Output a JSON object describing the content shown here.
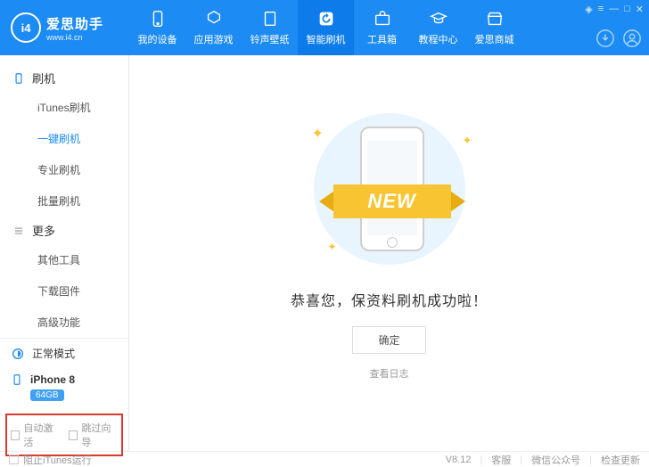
{
  "app": {
    "logo_mark": "i4",
    "name": "爱思助手",
    "domain": "www.i4.cn"
  },
  "nav": [
    {
      "label": "我的设备"
    },
    {
      "label": "应用游戏"
    },
    {
      "label": "铃声壁纸"
    },
    {
      "label": "智能刷机",
      "active": true
    },
    {
      "label": "工具箱"
    },
    {
      "label": "教程中心"
    },
    {
      "label": "爱思商城"
    }
  ],
  "sidebar": {
    "sections": [
      {
        "title": "刷机",
        "items": [
          {
            "label": "iTunes刷机"
          },
          {
            "label": "一键刷机",
            "active": true
          },
          {
            "label": "专业刷机"
          },
          {
            "label": "批量刷机"
          }
        ]
      },
      {
        "title": "更多",
        "items": [
          {
            "label": "其他工具"
          },
          {
            "label": "下载固件"
          },
          {
            "label": "高级功能"
          }
        ]
      }
    ],
    "status": {
      "mode": "正常模式",
      "device": "iPhone 8",
      "capacity": "64GB"
    },
    "options": {
      "auto_activate": "自动激活",
      "skip_guide": "跳过向导"
    }
  },
  "main": {
    "ribbon": "NEW",
    "success_text": "恭喜您，保资料刷机成功啦！",
    "ok_btn": "确定",
    "log_link": "查看日志"
  },
  "footer": {
    "block_itunes": "阻止iTunes运行",
    "version": "V8.12",
    "support": "客服",
    "wechat": "微信公众号",
    "update": "检查更新"
  }
}
